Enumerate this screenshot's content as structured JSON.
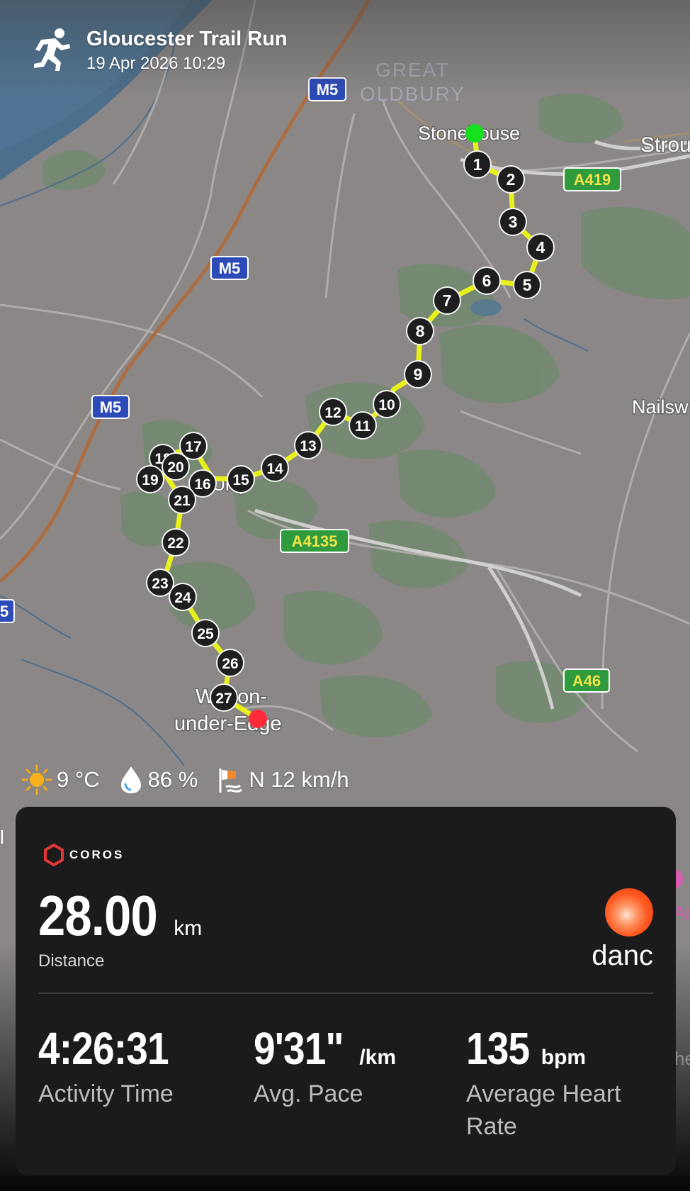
{
  "header": {
    "title": "Gloucester Trail Run",
    "datetime": "19 Apr 2026 10:29",
    "icon": "running-person-icon"
  },
  "map": {
    "route_color": "#e8f21a",
    "start_color": "#14e01e",
    "end_color": "#ff2a3a",
    "place_labels": [
      "GREAT",
      "OLDBURY",
      "Stonehouse",
      "Strou",
      "Nailsw",
      "Uley",
      "Wotton-",
      "under-Edge"
    ],
    "road_labels": [
      "M5",
      "M5",
      "M5",
      "5",
      "A419",
      "A4135",
      "A46"
    ],
    "markers": [
      "1",
      "2",
      "3",
      "4",
      "5",
      "6",
      "7",
      "8",
      "9",
      "10",
      "11",
      "12",
      "13",
      "14",
      "15",
      "16",
      "17",
      "18",
      "19",
      "20",
      "21",
      "22",
      "23",
      "24",
      "25",
      "26",
      "27"
    ]
  },
  "weather": {
    "temperature": "9 °C",
    "humidity": "86 %",
    "wind": "N 12 km/h",
    "icons": [
      "sun-icon",
      "water-drop-icon",
      "wind-flag-icon"
    ]
  },
  "card": {
    "brand": "COROS",
    "distance": {
      "value": "28.00",
      "unit": "km",
      "label": "Distance"
    },
    "user": {
      "name": "danc"
    },
    "stats": [
      {
        "value": "4:26:31",
        "unit": "",
        "label": "Activity Time"
      },
      {
        "value": "9'31\"",
        "unit": "/km",
        "label": "Avg. Pace"
      },
      {
        "value": "135",
        "unit": "bpm",
        "label": "Average Heart Rate"
      }
    ]
  }
}
